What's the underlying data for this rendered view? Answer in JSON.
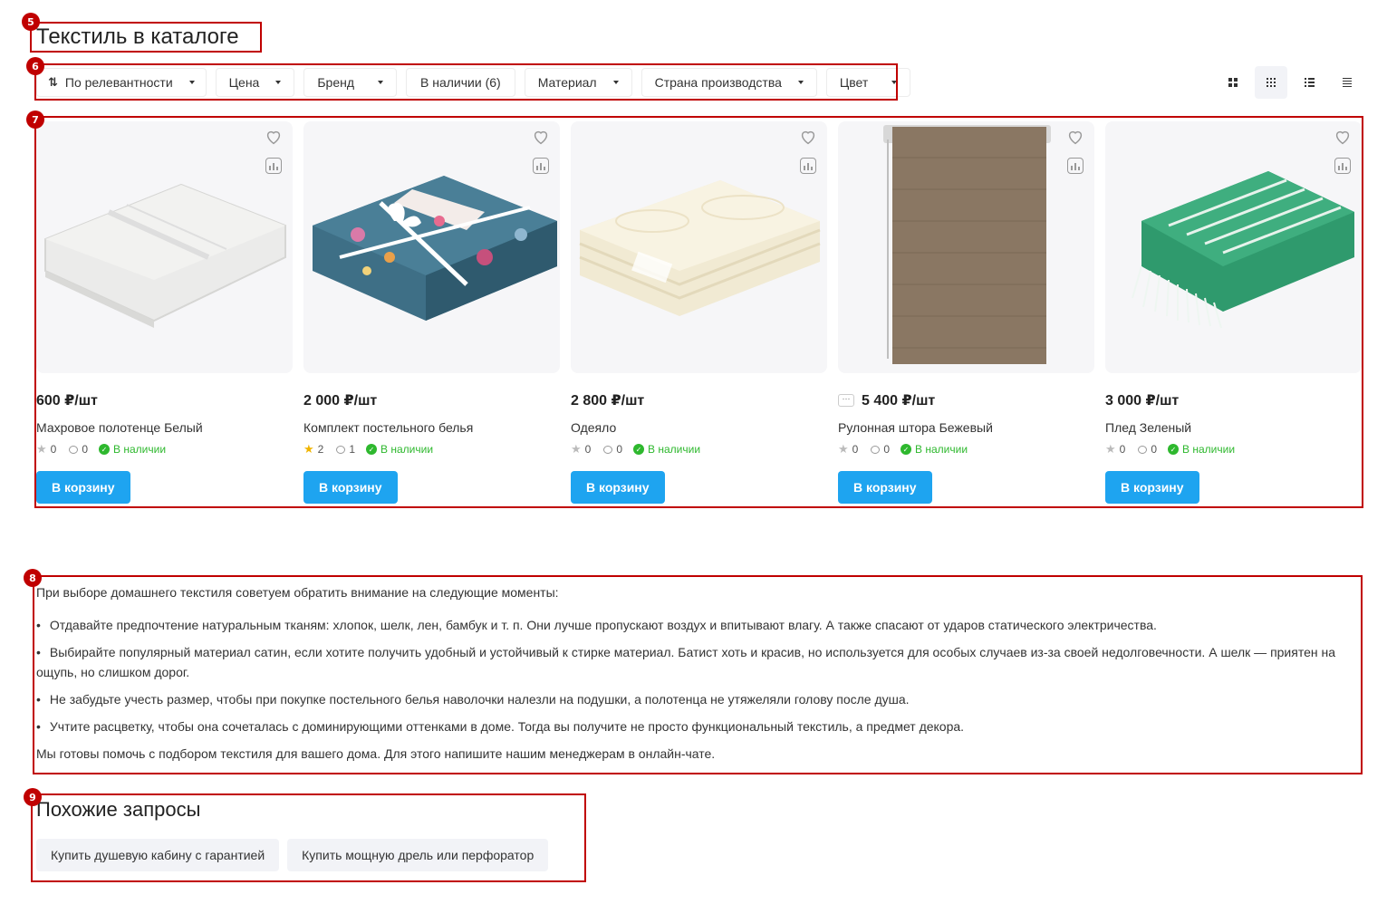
{
  "page": {
    "title": "Текстиль в каталоге"
  },
  "annotations": [
    "5",
    "6",
    "7",
    "8",
    "9"
  ],
  "filters": [
    {
      "label": "По релевантности",
      "icon": "sort-icon"
    },
    {
      "label": "Цена"
    },
    {
      "label": "Бренд"
    },
    {
      "label": "В наличии (6)"
    },
    {
      "label": "Материал"
    },
    {
      "label": "Страна производства"
    },
    {
      "label": "Цвет"
    }
  ],
  "view_modes": [
    "grid-large-icon",
    "grid-small-icon",
    "list-icon",
    "list-compact-icon"
  ],
  "cart_label": "В корзину",
  "stock_label": "В наличии",
  "products": [
    {
      "price": "600 ₽/шт",
      "name": "Махровое полотенце Белый",
      "rating": "0",
      "reviews": "0",
      "image": "towel"
    },
    {
      "price": "2 000 ₽/шт",
      "name": "Комплект постельного белья",
      "rating": "2",
      "reviews": "1",
      "image": "bedding"
    },
    {
      "price": "2 800 ₽/шт",
      "name": "Одеяло",
      "rating": "0",
      "reviews": "0",
      "image": "blanket"
    },
    {
      "price": "5 400 ₽/шт",
      "name": "Рулонная штора Бежевый",
      "rating": "0",
      "reviews": "0",
      "image": "roller-blind"
    },
    {
      "price": "3 000 ₽/шт",
      "name": "Плед Зеленый",
      "rating": "0",
      "reviews": "0",
      "image": "plaid"
    }
  ],
  "description": {
    "intro": "При выборе домашнего текстиля советуем обратить внимание на следующие моменты:",
    "bullets": [
      "Отдавайте предпочтение натуральным тканям: хлопок, шелк, лен, бамбук и т. п. Они лучше пропускают воздух и впитывают влагу. А также спасают от ударов статического электричества.",
      "Выбирайте популярный материал сатин, если хотите получить удобный и устойчивый к стирке материал. Батист хоть и красив, но используется для особых случаев из-за своей недолговечности. А шелк — приятен на ощупь, но слишком дорог.",
      "Не забудьте учесть размер, чтобы при покупке постельного белья наволочки налезли на подушки, а полотенца не утяжеляли голову после душа.",
      "Учтите расцветку, чтобы она сочеталась с доминирующими оттенками в доме. Тогда вы получите не просто функциональный текстиль, а предмет декора."
    ],
    "outro": "Мы готовы помочь с подбором текстиля для вашего дома. Для этого напишите нашим менеджерам в онлайн-чате."
  },
  "similar": {
    "title": "Похожие запросы",
    "tags": [
      "Купить душевую кабину с гарантией",
      "Купить мощную дрель или перфоратор"
    ]
  },
  "colors": {
    "accent": "#1ea4f0",
    "in_stock": "#2eb82e",
    "annotation": "#c00000",
    "rating_star": "#f0b400"
  }
}
